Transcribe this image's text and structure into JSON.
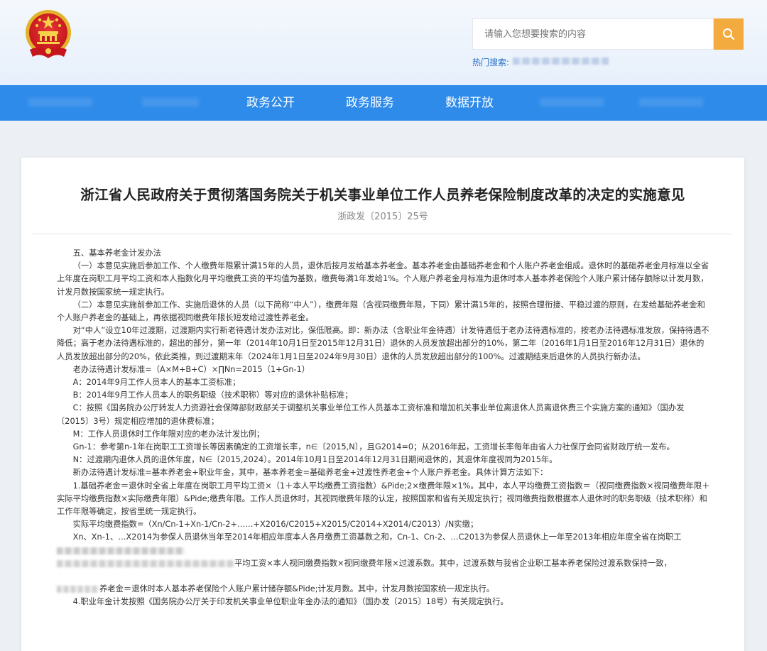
{
  "search": {
    "placeholder": "请输入您想要搜索的内容",
    "hot_label": "热门搜索:"
  },
  "nav": {
    "items": [
      {
        "label": "政务公开"
      },
      {
        "label": "政务服务"
      },
      {
        "label": "数据开放"
      }
    ]
  },
  "colors": {
    "nav_bg": "#2e8bea",
    "search_button": "#f3aa3f",
    "hot_search_text": "#2a73c8"
  },
  "icons": {
    "emblem": "national-emblem-icon",
    "search": "search-icon"
  },
  "article": {
    "title": "浙江省人民政府关于贯彻落国务院关于机关事业单位工作人员养老保险制度改革的决定的实施意见",
    "doc_number": "浙政发〔2015〕25号",
    "lines": [
      "五、基本养老金计发办法",
      "（一）本意见实施后参加工作、个人缴费年限累计满15年的人员，退休后按月发给基本养老金。基本养老金由基础养老金和个人账户养老金组成。退休时的基础养老金月标准以全省上年度在岗职工月平均工资和本人指数化月平均缴费工资的平均值为基数，缴费每满1年发给1%。个人账户养老金月标准为退休时本人基本养老保险个人账户累计储存额除以计发月数，计发月数按国家统一规定执行。",
      "（二）本意见实施前参加工作、实施后退休的人员（以下简称“中人”），缴费年限（含视同缴费年限，下同）累计满15年的，按照合理衔接、平稳过渡的原则，在发给基础养老金和个人账户养老金的基础上，再依据视同缴费年限长短发给过渡性养老金。",
      "对“中人”设立10年过渡期，过渡期内实行新老待遇计发办法对比，保低限高。即：新办法（含职业年金待遇）计发待遇低于老办法待遇标准的，按老办法待遇标准发放，保持待遇不降低；高于老办法待遇标准的，超出的部分，第一年（2014年10月1日至2015年12月31日）退休的人员发放超出部分的10%，第二年（2016年1月1日至2016年12月31日）退休的人员发放超出部分的20%，依此类推，到过渡期末年（2024年1月1日至2024年9月30日）退休的人员发放超出部分的100%。过渡期结束后退休的人员执行新办法。",
      "老办法待遇计发标准=（A×M+B+C）×∏Nn=2015（1+Gn-1）",
      "A：2014年9月工作人员本人的基本工资标准；",
      "B：2014年9月工作人员本人的职务职级（技术职称）等对应的退休补贴标准；",
      "C：按照《国务院办公厅转发人力资源社会保障部财政部关于调整机关事业单位工作人员基本工资标准和增加机关事业单位离退休人员离退休费三个实施方案的通知》（国办发〔2015〕3号）规定相应增加的退休费标准；",
      "M：工作人员退休时工作年限对应的老办法计发比例；",
      "Gn-1：参考第n-1年在岗职工工资增长等因素确定的工资增长率，n∈〔2015,N〕，且G2014=0；从2016年起，工资增长率每年由省人力社保厅会同省财政厅统一发布。",
      "N：过渡期内退休人员的退休年度，N∈〔2015,2024〕。2014年10月1日至2014年12月31日期间退休的，其退休年度视同为2015年。",
      "新办法待遇计发标准=基本养老金+职业年金，其中，基本养老金=基础养老金+过渡性养老金+个人账户养老金。具体计算方法如下：",
      "1.基础养老金＝退休时全省上年度在岗职工月平均工资×（1＋本人平均缴费工资指数）&Pide;2×缴费年限×1%。其中，本人平均缴费工资指数＝（视同缴费指数×视同缴费年限＋实际平均缴费指数×实际缴费年限）&Pide;缴费年限。工作人员退休时，其视同缴费年限的认定，按照国家和省有关规定执行；视同缴费指数根据本人退休时的职务职级（技术职称）和工作年限等确定，按省里统一规定执行。",
      "实际平均缴费指数=（Xn/Cn-1+Xn-1/Cn-2+……+X2016/C2015+X2015/C2014+X2014/C2013）/N实缴；",
      "Xn、Xn-1、…X2014为参保人员退休当年至2014年相应年度本人各月缴费工资基数之和，Cn-1、Cn-2、…C2013为参保人员退休上一年至2013年相应年度全省在岗职工",
      "平均工资×本人视同缴费指数×视同缴费年限×过渡系数。其中，过渡系数与我省企业职工基本养老保险过渡系数保持一致，",
      "养老金＝退休时本人基本养老保险个人账户累计储存额&Pide;计发月数。其中，计发月数按国家统一规定执行。",
      "4.职业年金计发按照《国务院办公厅关于印发机关事业单位职业年金办法的通知》（国办发〔2015〕18号）有关规定执行。"
    ]
  }
}
